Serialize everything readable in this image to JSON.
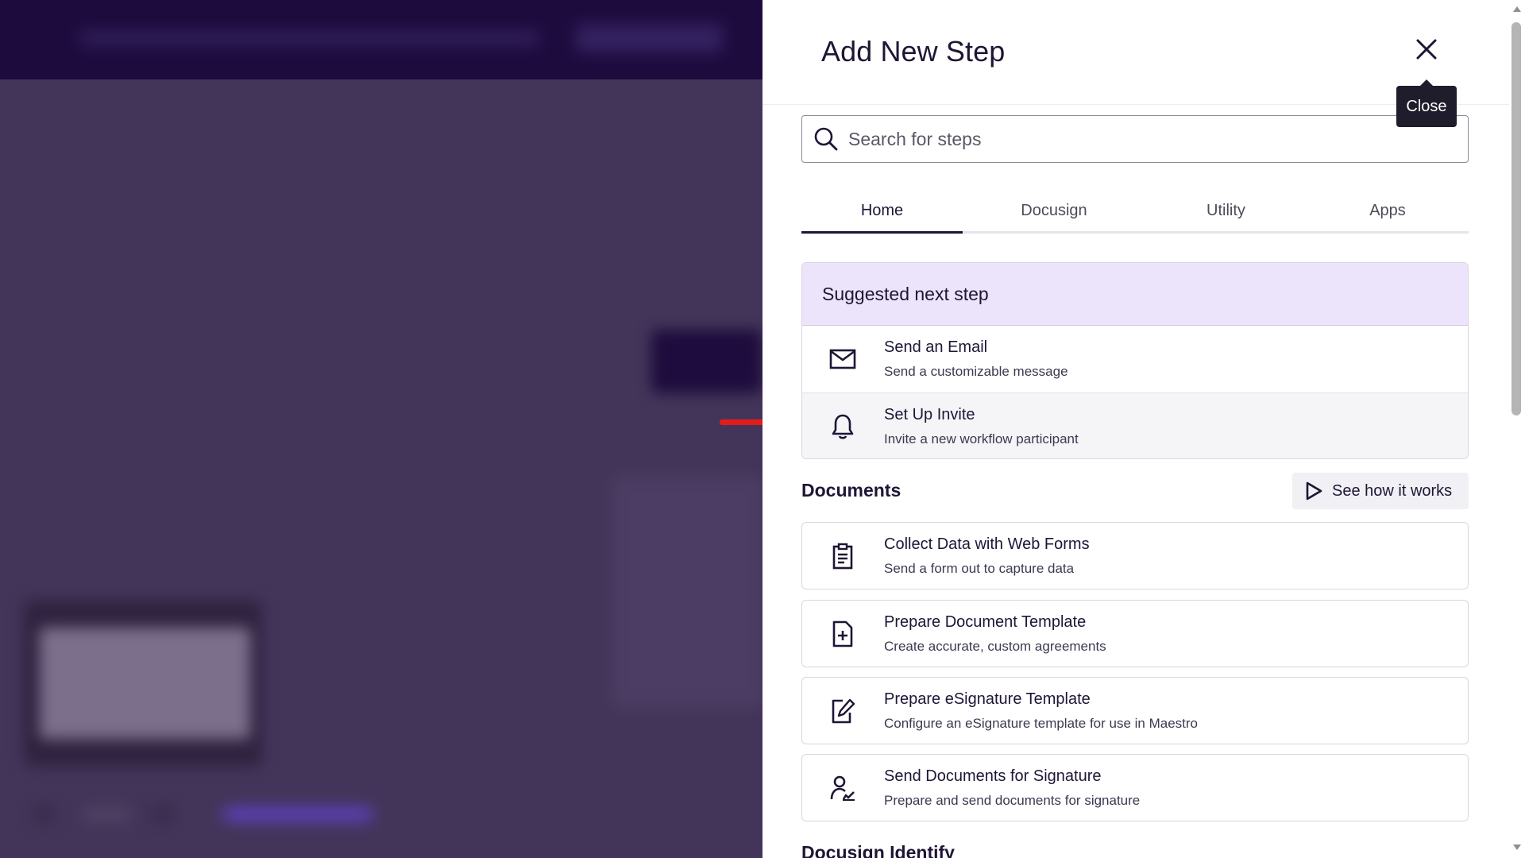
{
  "panel": {
    "title": "Add New Step",
    "close_tooltip": "Close"
  },
  "search": {
    "placeholder": "Search for steps",
    "value": ""
  },
  "tabs": [
    {
      "label": "Home",
      "active": true
    },
    {
      "label": "Docusign",
      "active": false
    },
    {
      "label": "Utility",
      "active": false
    },
    {
      "label": "Apps",
      "active": false
    }
  ],
  "suggested": {
    "heading": "Suggested next step",
    "items": [
      {
        "title": "Send an Email",
        "desc": "Send a customizable message",
        "icon": "envelope-icon"
      },
      {
        "title": "Set Up Invite",
        "desc": "Invite a new workflow participant",
        "icon": "bell-icon"
      }
    ]
  },
  "documents": {
    "heading": "Documents",
    "see_how_label": "See how it works",
    "items": [
      {
        "title": "Collect Data with Web Forms",
        "desc": "Send a form out to capture data",
        "icon": "clipboard-icon"
      },
      {
        "title": "Prepare Document Template",
        "desc": "Create accurate, custom agreements",
        "icon": "document-plus-icon"
      },
      {
        "title": "Prepare eSignature Template",
        "desc": "Configure an eSignature template for use in Maestro",
        "icon": "edit-document-icon"
      },
      {
        "title": "Send Documents for Signature",
        "desc": "Prepare and send documents for signature",
        "icon": "person-sign-icon"
      }
    ]
  },
  "next_section": {
    "heading": "Docusign Identify"
  },
  "colors": {
    "backdrop": "#43355a",
    "topbar": "#1e0b3e",
    "suggested_header_bg": "#ece4fb",
    "text_primary": "#1f1535",
    "tooltip_bg": "#1f1d2b",
    "annotation_arrow": "#e31b1b"
  }
}
